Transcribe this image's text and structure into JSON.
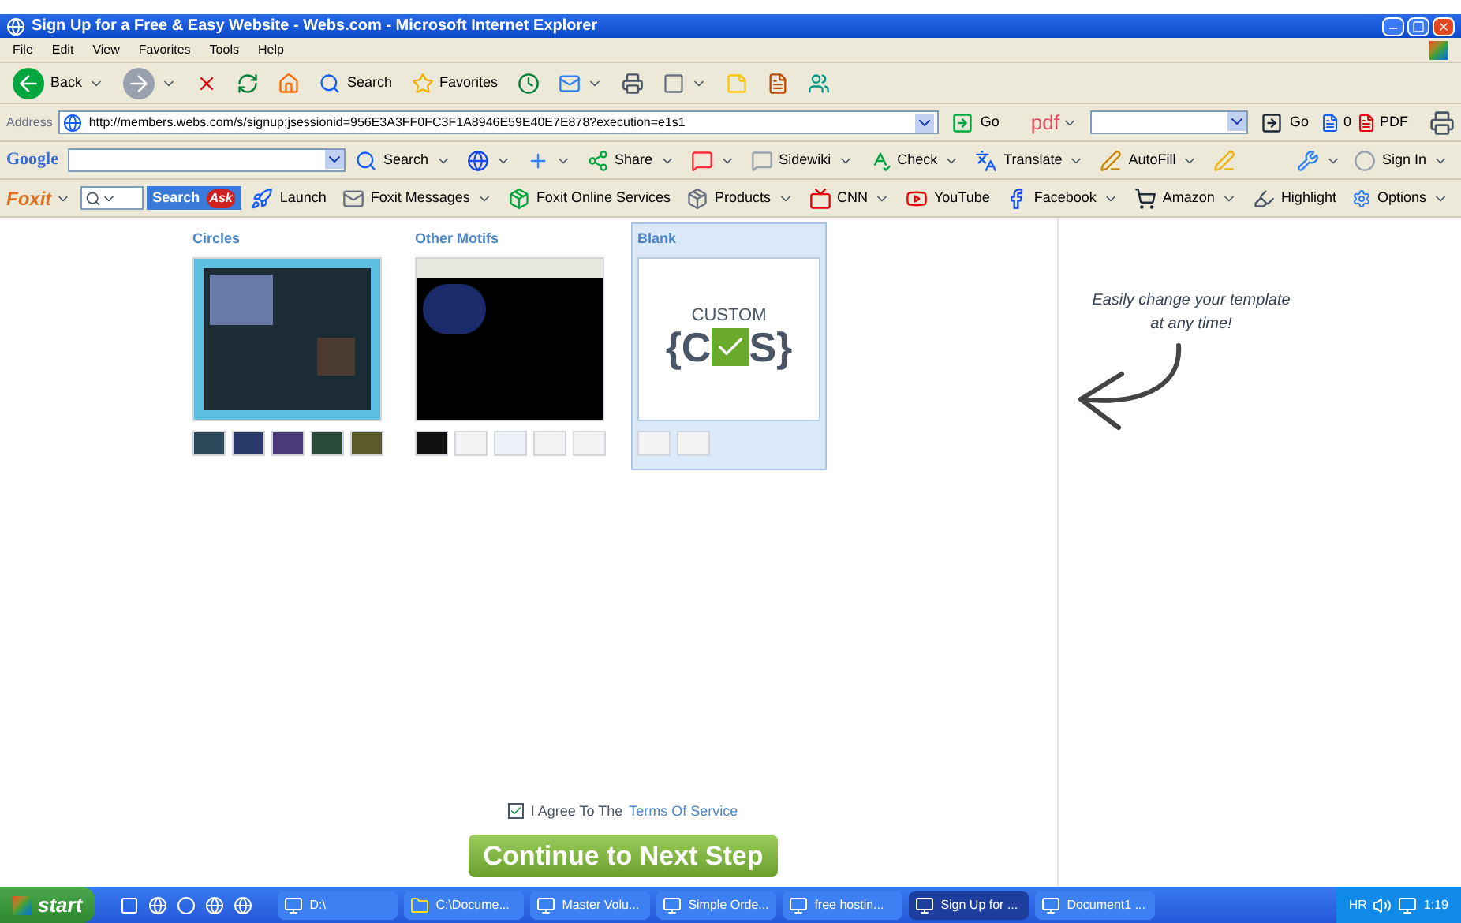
{
  "window": {
    "title": "Sign Up for a Free & Easy Website - Webs.com - Microsoft Internet Explorer"
  },
  "menu": [
    "File",
    "Edit",
    "View",
    "Favorites",
    "Tools",
    "Help"
  ],
  "toolbar": [
    {
      "label": "Back",
      "dropdown": true
    },
    {
      "dropdown": true
    },
    {
      "dropdown": false
    },
    {
      "dropdown": false
    },
    {
      "dropdown": false
    },
    {
      "label": "Search",
      "dropdown": false
    },
    {
      "label": "Favorites",
      "dropdown": false
    },
    {
      "dropdown": false
    },
    {
      "dropdown": true
    },
    {
      "dropdown": false
    },
    {
      "dropdown": true
    },
    {
      "dropdown": false
    },
    {
      "dropdown": false
    },
    {
      "dropdown": false
    }
  ],
  "address": {
    "label": "Address",
    "url": "http://members.webs.com/s/signup;jsessionid=956E3A3FF0FC3F1A8946E59E40E7E878?execution=e1s1",
    "go": "Go"
  },
  "pdfbar": {
    "logo": "pdf",
    "go": "Go",
    "count": "0",
    "pdf": "PDF"
  },
  "google": {
    "logo": "Google",
    "items": [
      {
        "label": "Search",
        "dropdown": true
      },
      {
        "dropdown": true
      },
      {
        "dropdown": true
      },
      {
        "label": "Share",
        "dropdown": true
      },
      {
        "dropdown": true
      },
      {
        "label": "Sidewiki",
        "dropdown": true
      },
      {
        "label": "Check",
        "dropdown": true
      },
      {
        "label": "Translate",
        "dropdown": true
      },
      {
        "label": "AutoFill",
        "dropdown": true
      },
      {
        "dropdown": false
      }
    ],
    "right": [
      {
        "dropdown": true
      },
      {
        "label": "Sign In",
        "dropdown": true
      }
    ]
  },
  "foxit": {
    "logo": "Foxit",
    "search": "Search",
    "ask": "Ask",
    "items": [
      {
        "label": "Launch",
        "dropdown": false
      },
      {
        "label": "Foxit Messages",
        "dropdown": true
      },
      {
        "label": "Foxit Online Services",
        "dropdown": false
      },
      {
        "label": "Products",
        "dropdown": true
      },
      {
        "label": "CNN",
        "dropdown": true
      },
      {
        "label": "YouTube",
        "dropdown": false
      },
      {
        "label": "Facebook",
        "dropdown": true
      },
      {
        "label": "Amazon",
        "dropdown": true
      },
      {
        "label": "Highlight",
        "dropdown": false
      }
    ],
    "options": "Options"
  },
  "templates": [
    {
      "name": "Circles",
      "kind": "circles",
      "selected": false,
      "thumbs": [
        {
          "color": "#2a4a5a"
        },
        {
          "color": "#2a3a6a"
        },
        {
          "color": "#4a3a7a"
        },
        {
          "color": "#2a4a3a"
        },
        {
          "color": "#5a5a2a"
        }
      ]
    },
    {
      "name": "Other Motifs",
      "kind": "motifs",
      "selected": false,
      "thumbs": [
        {
          "color": "#101010"
        },
        {
          "color": "#f4f4f4"
        },
        {
          "color": "#eef2f8"
        },
        {
          "color": "#f4f4f4"
        },
        {
          "color": "#f4f4f4"
        }
      ]
    },
    {
      "name": "Blank",
      "kind": "blank",
      "selected": true,
      "logo_top": "CUSTOM",
      "logo_left": "{C",
      "logo_right": "S}",
      "thumbs": [
        {
          "color": "#f4f4f4"
        },
        {
          "color": "#f4f4f4"
        }
      ]
    }
  ],
  "note": {
    "line1": "Easily change your template",
    "line2": "at any time!"
  },
  "agree": {
    "checked": true,
    "text": "I Agree To The",
    "link": "Terms Of Service"
  },
  "continue": "Continue to Next Step",
  "taskbar": {
    "start": "start",
    "tasks": [
      {
        "label": "D:\\",
        "selected": false
      },
      {
        "label": "C:\\Docume...",
        "selected": false
      },
      {
        "label": "Master Volu...",
        "selected": false
      },
      {
        "label": "Simple Orde...",
        "selected": false
      },
      {
        "label": "free hostin...",
        "selected": false
      },
      {
        "label": "Sign Up for ...",
        "selected": true
      },
      {
        "label": "Document1 ...",
        "selected": false
      }
    ],
    "lang": "HR",
    "clock": "1:19"
  }
}
